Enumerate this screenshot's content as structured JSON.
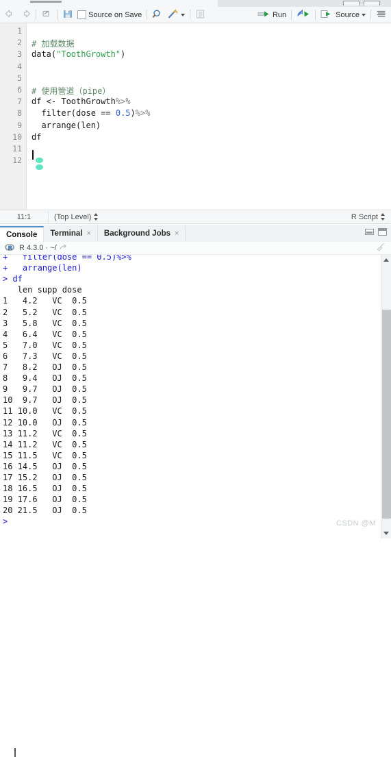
{
  "window": {
    "minimize_icon": "minimize-icon",
    "maximize_icon": "maximize-icon"
  },
  "source_toolbar": {
    "back_icon": "back-arrow-icon",
    "forward_icon": "forward-arrow-icon",
    "popout_icon": "popout-window-icon",
    "save_icon": "save-disk-icon",
    "source_on_save_label": "Source on Save",
    "find_icon": "magnifier-icon",
    "wand_icon": "magic-wand-icon",
    "wand_caret_icon": "chevron-down-icon",
    "compile_report_icon": "compile-report-icon",
    "run_label": "Run",
    "run_icon": "run-arrow-icon",
    "rerun_icon": "rerun-arrow-icon",
    "source_label": "Source",
    "source_icon": "source-arrow-icon",
    "source_caret_icon": "chevron-down-icon",
    "outline_icon": "document-outline-icon"
  },
  "editor": {
    "line_numbers": [
      "1",
      "2",
      "3",
      "4",
      "5",
      "6",
      "7",
      "8",
      "9",
      "10",
      "11",
      "12"
    ],
    "lines": [
      {
        "n": 1,
        "segments": []
      },
      {
        "n": 2,
        "segments": [
          {
            "t": "# 加载数据",
            "c": "cmt"
          }
        ]
      },
      {
        "n": 3,
        "segments": [
          {
            "t": "data(",
            "c": ""
          },
          {
            "t": "\"ToothGrowth\"",
            "c": "str"
          },
          {
            "t": ")",
            "c": ""
          }
        ]
      },
      {
        "n": 4,
        "segments": []
      },
      {
        "n": 5,
        "segments": []
      },
      {
        "n": 6,
        "segments": [
          {
            "t": "# 使用管道（pipe）",
            "c": "cmt"
          }
        ]
      },
      {
        "n": 7,
        "segments": [
          {
            "t": "df <- ToothGrowth",
            "c": ""
          },
          {
            "t": "%>%",
            "c": "op"
          }
        ]
      },
      {
        "n": 8,
        "segments": [
          {
            "t": "  filter(dose == ",
            "c": ""
          },
          {
            "t": "0.5",
            "c": "num"
          },
          {
            "t": ")",
            "c": ""
          },
          {
            "t": "%>%",
            "c": "op"
          }
        ]
      },
      {
        "n": 9,
        "segments": [
          {
            "t": "  arrange(len)",
            "c": ""
          }
        ]
      },
      {
        "n": 10,
        "segments": [
          {
            "t": "df",
            "c": ""
          }
        ]
      },
      {
        "n": 11,
        "segments": []
      },
      {
        "n": 12,
        "segments": []
      }
    ]
  },
  "source_status": {
    "cursor_position": "11:1",
    "scope": "(Top Level)",
    "file_type": "R Script"
  },
  "console_panel": {
    "tabs": [
      {
        "label": "Console",
        "active": true,
        "closable": false
      },
      {
        "label": "Terminal",
        "active": false,
        "closable": true
      },
      {
        "label": "Background Jobs",
        "active": false,
        "closable": true
      }
    ],
    "close_glyph": "×",
    "r_logo": "r-logo-icon",
    "r_version": "R 4.3.0 · ~/",
    "directory_icon": "open-directory-icon",
    "broom_icon": "clear-console-broom-icon",
    "minimize_icon": "minimize-panel-icon",
    "maximize_icon": "maximize-panel-icon",
    "output_lines": [
      {
        "t": "+   filter(dose == 0.5)%>%",
        "c": "cblue"
      },
      {
        "t": "+   arrange(len)",
        "c": "cblue"
      },
      {
        "t": "> df",
        "c": "cblue"
      },
      {
        "t": "   len supp dose",
        "c": ""
      },
      {
        "t": "1   4.2   VC  0.5",
        "c": ""
      },
      {
        "t": "2   5.2   VC  0.5",
        "c": ""
      },
      {
        "t": "3   5.8   VC  0.5",
        "c": ""
      },
      {
        "t": "4   6.4   VC  0.5",
        "c": ""
      },
      {
        "t": "5   7.0   VC  0.5",
        "c": ""
      },
      {
        "t": "6   7.3   VC  0.5",
        "c": ""
      },
      {
        "t": "7   8.2   OJ  0.5",
        "c": ""
      },
      {
        "t": "8   9.4   OJ  0.5",
        "c": ""
      },
      {
        "t": "9   9.7   OJ  0.5",
        "c": ""
      },
      {
        "t": "10  9.7   OJ  0.5",
        "c": ""
      },
      {
        "t": "11 10.0   VC  0.5",
        "c": ""
      },
      {
        "t": "12 10.0   OJ  0.5",
        "c": ""
      },
      {
        "t": "13 11.2   VC  0.5",
        "c": ""
      },
      {
        "t": "14 11.2   VC  0.5",
        "c": ""
      },
      {
        "t": "15 11.5   VC  0.5",
        "c": ""
      },
      {
        "t": "16 14.5   OJ  0.5",
        "c": ""
      },
      {
        "t": "17 15.2   OJ  0.5",
        "c": ""
      },
      {
        "t": "18 16.5   OJ  0.5",
        "c": ""
      },
      {
        "t": "19 17.6   OJ  0.5",
        "c": ""
      },
      {
        "t": "20 21.5   OJ  0.5",
        "c": ""
      },
      {
        "t": ">",
        "c": "cprompt"
      }
    ]
  },
  "watermark": "CSDN @M",
  "colors": {
    "accent": "#4b8ecc",
    "comment": "#5e8b67",
    "string": "#2c9e4b",
    "number": "#2f5fd0",
    "console_blue": "#1a1ad0",
    "toolbar_bg": "#f5f7f8",
    "gutter_bg": "#f0f0f0",
    "marker_teal": "#5fe3c0"
  }
}
